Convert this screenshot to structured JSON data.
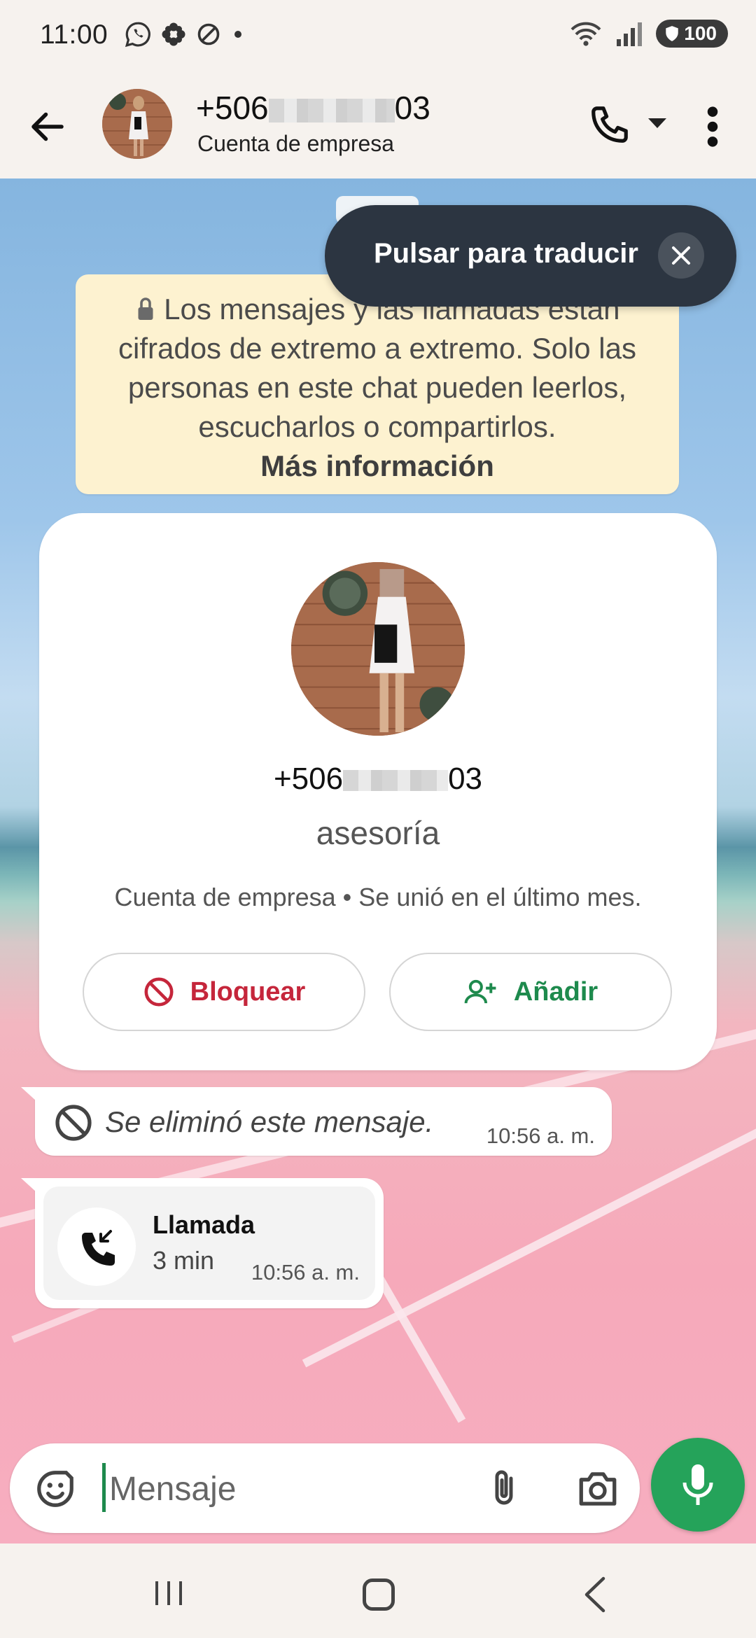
{
  "status_bar": {
    "time": "11:00",
    "battery": "100",
    "left_icons": [
      "whatsapp-icon",
      "flower-icon",
      "blocked-icon",
      "dot-icon"
    ],
    "right_icons": [
      "wifi-icon",
      "signal-icon",
      "battery-icon"
    ]
  },
  "header": {
    "title_prefix": "+506",
    "title_suffix": "03",
    "subtitle": "Cuenta de empresa"
  },
  "translate": {
    "label": "Pulsar para traducir"
  },
  "encryption": {
    "text": "Los mensajes y las llamadas están cifrados de extremo a extremo. Solo las personas en este chat pueden leerlos, escucharlos o compartirlos.",
    "link": "Más información"
  },
  "profile_card": {
    "phone_prefix": "+506",
    "phone_suffix": "03",
    "name": "asesoría",
    "info": "Cuenta de empresa • Se unió en el último mes.",
    "block_label": "Bloquear",
    "add_label": "Añadir"
  },
  "messages": [
    {
      "type": "deleted",
      "text": "Se eliminó este mensaje.",
      "time": "10:56 a. m."
    },
    {
      "type": "call",
      "title": "Llamada",
      "duration": "3 min",
      "time": "10:56 a. m."
    }
  ],
  "composer": {
    "placeholder": "Mensaje"
  },
  "colors": {
    "accent_green": "#25a35a",
    "block_red": "#c5263b",
    "encryption_bg": "#fdf2d0",
    "translate_pill": "#2c3541"
  }
}
